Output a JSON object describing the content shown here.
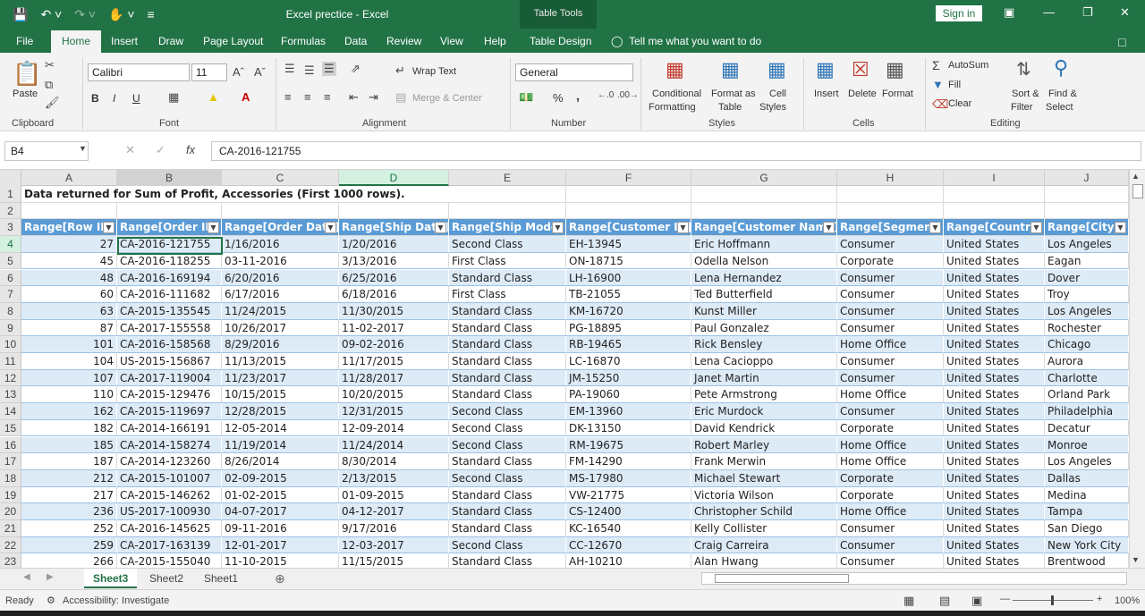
{
  "window": {
    "title": "Excel prectice  -  Excel",
    "context_tab_title": "Table Tools",
    "signin_label": "Sign in"
  },
  "ribbon_tabs": [
    "File",
    "Home",
    "Insert",
    "Draw",
    "Page Layout",
    "Formulas",
    "Data",
    "Review",
    "View",
    "Help",
    "Table Design"
  ],
  "tell_me": "Tell me what you want to do",
  "ribbon": {
    "clipboard": {
      "paste": "Paste",
      "label": "Clipboard"
    },
    "font": {
      "name": "Calibri",
      "size": "11",
      "bold": "B",
      "italic": "I",
      "underline": "U",
      "label": "Font"
    },
    "alignment": {
      "wrap_text": "Wrap Text",
      "merge_center": "Merge & Center",
      "label": "Alignment"
    },
    "number": {
      "format": "General",
      "percent": "%",
      "comma": ",",
      "label": "Number"
    },
    "styles": {
      "conditional": "Conditional",
      "conditional2": "Formatting",
      "format_as": "Format as",
      "format_as2": "Table",
      "cell": "Cell",
      "cell2": "Styles",
      "label": "Styles"
    },
    "cells": {
      "insert": "Insert",
      "delete": "Delete",
      "format": "Format",
      "label": "Cells"
    },
    "editing": {
      "autosum": "AutoSum",
      "fill": "Fill",
      "clear": "Clear",
      "sort": "Sort &",
      "sort2": "Filter",
      "find": "Find &",
      "find2": "Select",
      "label": "Editing"
    }
  },
  "formula_bar": {
    "name_box": "B4",
    "fx": "fx",
    "content": "CA-2016-121755"
  },
  "columns": [
    "A",
    "B",
    "C",
    "D",
    "E",
    "F",
    "G",
    "H",
    "I",
    "J"
  ],
  "row1_title": "Data returned for Sum of Profit, Accessories (First 1000 rows).",
  "table_headers": [
    "Range[Row ID]",
    "Range[Order ID]",
    "Range[Order Date]",
    "Range[Ship Date]",
    "Range[Ship Mode]",
    "Range[Customer ID]",
    "Range[Customer Name]",
    "Range[Segment]",
    "Range[Country]",
    "Range[City]"
  ],
  "rows": [
    {
      "n": "4",
      "c": [
        "27",
        "CA-2016-121755",
        "1/16/2016",
        "1/20/2016",
        "Second Class",
        "EH-13945",
        "Eric Hoffmann",
        "Consumer",
        "United States",
        "Los Angeles"
      ]
    },
    {
      "n": "5",
      "c": [
        "45",
        "CA-2016-118255",
        "03-11-2016",
        "3/13/2016",
        "First Class",
        "ON-18715",
        "Odella Nelson",
        "Corporate",
        "United States",
        "Eagan"
      ]
    },
    {
      "n": "6",
      "c": [
        "48",
        "CA-2016-169194",
        "6/20/2016",
        "6/25/2016",
        "Standard Class",
        "LH-16900",
        "Lena Hernandez",
        "Consumer",
        "United States",
        "Dover"
      ]
    },
    {
      "n": "7",
      "c": [
        "60",
        "CA-2016-111682",
        "6/17/2016",
        "6/18/2016",
        "First Class",
        "TB-21055",
        "Ted Butterfield",
        "Consumer",
        "United States",
        "Troy"
      ]
    },
    {
      "n": "8",
      "c": [
        "63",
        "CA-2015-135545",
        "11/24/2015",
        "11/30/2015",
        "Standard Class",
        "KM-16720",
        "Kunst Miller",
        "Consumer",
        "United States",
        "Los Angeles"
      ]
    },
    {
      "n": "9",
      "c": [
        "87",
        "CA-2017-155558",
        "10/26/2017",
        "11-02-2017",
        "Standard Class",
        "PG-18895",
        "Paul Gonzalez",
        "Consumer",
        "United States",
        "Rochester"
      ]
    },
    {
      "n": "10",
      "c": [
        "101",
        "CA-2016-158568",
        "8/29/2016",
        "09-02-2016",
        "Standard Class",
        "RB-19465",
        "Rick Bensley",
        "Home Office",
        "United States",
        "Chicago"
      ]
    },
    {
      "n": "11",
      "c": [
        "104",
        "US-2015-156867",
        "11/13/2015",
        "11/17/2015",
        "Standard Class",
        "LC-16870",
        "Lena Cacioppo",
        "Consumer",
        "United States",
        "Aurora"
      ]
    },
    {
      "n": "12",
      "c": [
        "107",
        "CA-2017-119004",
        "11/23/2017",
        "11/28/2017",
        "Standard Class",
        "JM-15250",
        "Janet Martin",
        "Consumer",
        "United States",
        "Charlotte"
      ]
    },
    {
      "n": "13",
      "c": [
        "110",
        "CA-2015-129476",
        "10/15/2015",
        "10/20/2015",
        "Standard Class",
        "PA-19060",
        "Pete Armstrong",
        "Home Office",
        "United States",
        "Orland Park"
      ]
    },
    {
      "n": "14",
      "c": [
        "162",
        "CA-2015-119697",
        "12/28/2015",
        "12/31/2015",
        "Second Class",
        "EM-13960",
        "Eric Murdock",
        "Consumer",
        "United States",
        "Philadelphia"
      ]
    },
    {
      "n": "15",
      "c": [
        "182",
        "CA-2014-166191",
        "12-05-2014",
        "12-09-2014",
        "Second Class",
        "DK-13150",
        "David Kendrick",
        "Corporate",
        "United States",
        "Decatur"
      ]
    },
    {
      "n": "16",
      "c": [
        "185",
        "CA-2014-158274",
        "11/19/2014",
        "11/24/2014",
        "Second Class",
        "RM-19675",
        "Robert Marley",
        "Home Office",
        "United States",
        "Monroe"
      ]
    },
    {
      "n": "17",
      "c": [
        "187",
        "CA-2014-123260",
        "8/26/2014",
        "8/30/2014",
        "Standard Class",
        "FM-14290",
        "Frank Merwin",
        "Home Office",
        "United States",
        "Los Angeles"
      ]
    },
    {
      "n": "18",
      "c": [
        "212",
        "CA-2015-101007",
        "02-09-2015",
        "2/13/2015",
        "Second Class",
        "MS-17980",
        "Michael Stewart",
        "Corporate",
        "United States",
        "Dallas"
      ]
    },
    {
      "n": "19",
      "c": [
        "217",
        "CA-2015-146262",
        "01-02-2015",
        "01-09-2015",
        "Standard Class",
        "VW-21775",
        "Victoria Wilson",
        "Corporate",
        "United States",
        "Medina"
      ]
    },
    {
      "n": "20",
      "c": [
        "236",
        "US-2017-100930",
        "04-07-2017",
        "04-12-2017",
        "Standard Class",
        "CS-12400",
        "Christopher Schild",
        "Home Office",
        "United States",
        "Tampa"
      ]
    },
    {
      "n": "21",
      "c": [
        "252",
        "CA-2016-145625",
        "09-11-2016",
        "9/17/2016",
        "Standard Class",
        "KC-16540",
        "Kelly Collister",
        "Consumer",
        "United States",
        "San Diego"
      ]
    },
    {
      "n": "22",
      "c": [
        "259",
        "CA-2017-163139",
        "12-01-2017",
        "12-03-2017",
        "Second Class",
        "CC-12670",
        "Craig Carreira",
        "Consumer",
        "United States",
        "New York City"
      ]
    },
    {
      "n": "23",
      "c": [
        "266",
        "CA-2015-155040",
        "11-10-2015",
        "11/15/2015",
        "Standard Class",
        "AH-10210",
        "Alan Hwang",
        "Consumer",
        "United States",
        "Brentwood"
      ]
    }
  ],
  "sheets": [
    "Sheet3",
    "Sheet2",
    "Sheet1"
  ],
  "status": {
    "ready": "Ready",
    "accessibility": "Accessibility: Investigate",
    "zoom": "100%"
  }
}
